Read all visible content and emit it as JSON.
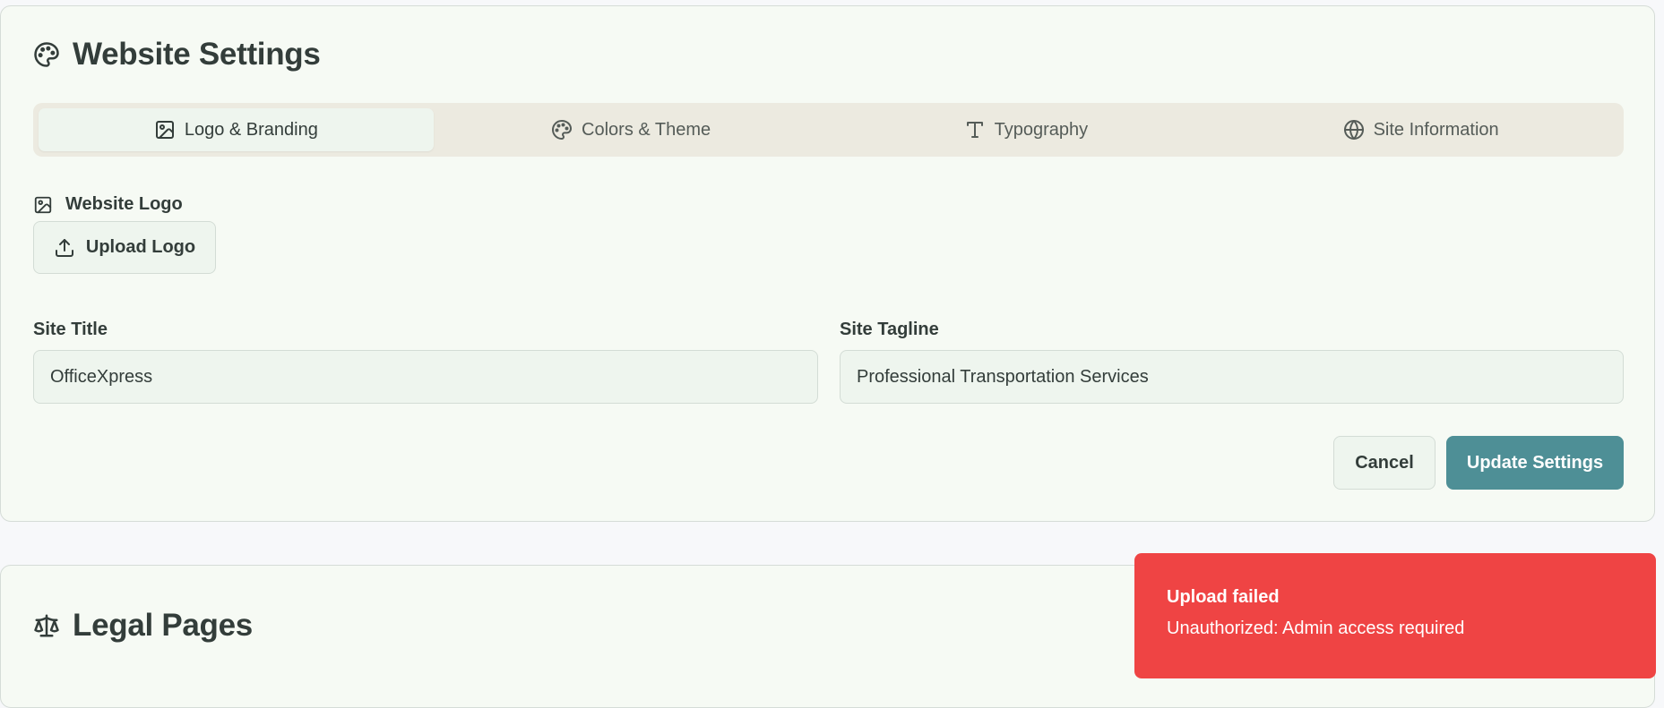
{
  "settings": {
    "title": "Website Settings",
    "title_icon": "palette-icon",
    "tabs": [
      {
        "label": "Logo & Branding",
        "icon": "image-icon",
        "active": true
      },
      {
        "label": "Colors & Theme",
        "icon": "palette-icon",
        "active": false
      },
      {
        "label": "Typography",
        "icon": "type-icon",
        "active": false
      },
      {
        "label": "Site Information",
        "icon": "globe-icon",
        "active": false
      }
    ],
    "logo": {
      "label": "Website Logo",
      "upload_label": "Upload Logo"
    },
    "site_title": {
      "label": "Site Title",
      "value": "OfficeXpress"
    },
    "site_tagline": {
      "label": "Site Tagline",
      "value": "Professional Transportation Services"
    },
    "cancel_label": "Cancel",
    "update_label": "Update Settings"
  },
  "legal": {
    "title": "Legal Pages",
    "title_icon": "scale-icon"
  },
  "toast": {
    "title": "Upload failed",
    "message": "Unauthorized: Admin access required"
  },
  "colors": {
    "accent": "#4e8f96",
    "error": "#ef4444",
    "card_bg": "#f6faf4",
    "tabs_bg": "#eceae0"
  }
}
